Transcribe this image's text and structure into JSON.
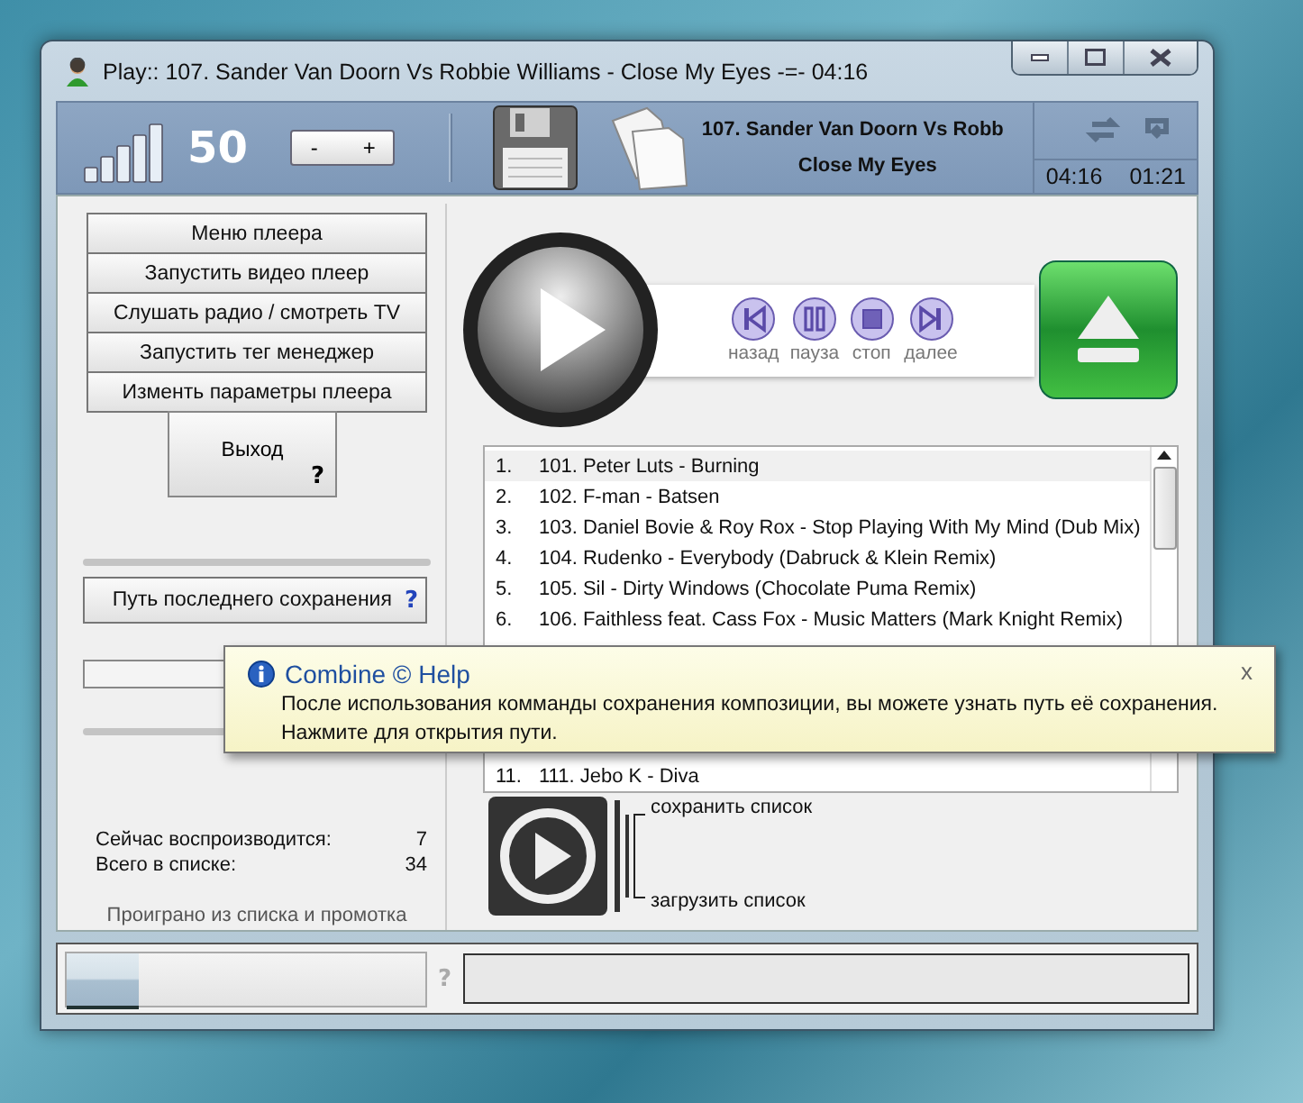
{
  "window": {
    "title": "Play:: 107. Sander Van Doorn Vs Robbie Williams - Close My Eyes -=- 04:16"
  },
  "header": {
    "volume": "50",
    "volume_buttons": [
      "-",
      "+"
    ],
    "track_lines": [
      "107. Sander Van Doorn Vs Robb",
      "Close My Eyes"
    ],
    "times": [
      "04:16",
      "01:21"
    ]
  },
  "menu": [
    "Меню плеера",
    "Запустить видео плеер",
    "Слушать радио / смотреть TV",
    "Запустить тег менеджер",
    "Изменть параметры плеера"
  ],
  "exit": {
    "label": "Выход",
    "help": "?"
  },
  "save_path": {
    "label": "Путь последнего сохранения",
    "help": "?"
  },
  "stats": [
    {
      "label": "Сейчас воспроизводится:",
      "value": "7"
    },
    {
      "label": "Всего в списке:",
      "value": "34"
    }
  ],
  "footer_caption": "Проиграно из списка и промотка",
  "transport": [
    {
      "kind": "prev",
      "label": "назад"
    },
    {
      "kind": "pause",
      "label": "пауза"
    },
    {
      "kind": "stop",
      "label": "стоп"
    },
    {
      "kind": "next",
      "label": "далее"
    }
  ],
  "playlist": [
    {
      "number": "1.",
      "title": "101. Peter Luts - Burning",
      "selected": true
    },
    {
      "number": "2.",
      "title": "102. F-man - Batsen",
      "selected": false
    },
    {
      "number": "3.",
      "title": "103. Daniel Bovie & Roy Rox - Stop Playing With My Mind (Dub Mix)",
      "selected": false
    },
    {
      "number": "4.",
      "title": "104. Rudenko - Everybody (Dabruck & Klein Remix)",
      "selected": false
    },
    {
      "number": "5.",
      "title": "105. Sil - Dirty Windows (Chocolate Puma Remix)",
      "selected": false
    },
    {
      "number": "6.",
      "title": "106. Faithless feat. Cass Fox - Music Matters (Mark Knight Remix)",
      "selected": false
    },
    {
      "number": "11.",
      "title": "111. Jebo K - Diva",
      "selected": false
    }
  ],
  "list_actions": [
    "сохранить список",
    "загрузить список"
  ],
  "status": {
    "progress": {
      "level": 0.2
    },
    "help": "?"
  },
  "tooltip": {
    "title": "Combine © Help",
    "lines": [
      "После использования комманды сохранения композиции, вы можете узнать путь её сохранения.",
      "Нажмите для открытия пути."
    ],
    "close": "x"
  }
}
